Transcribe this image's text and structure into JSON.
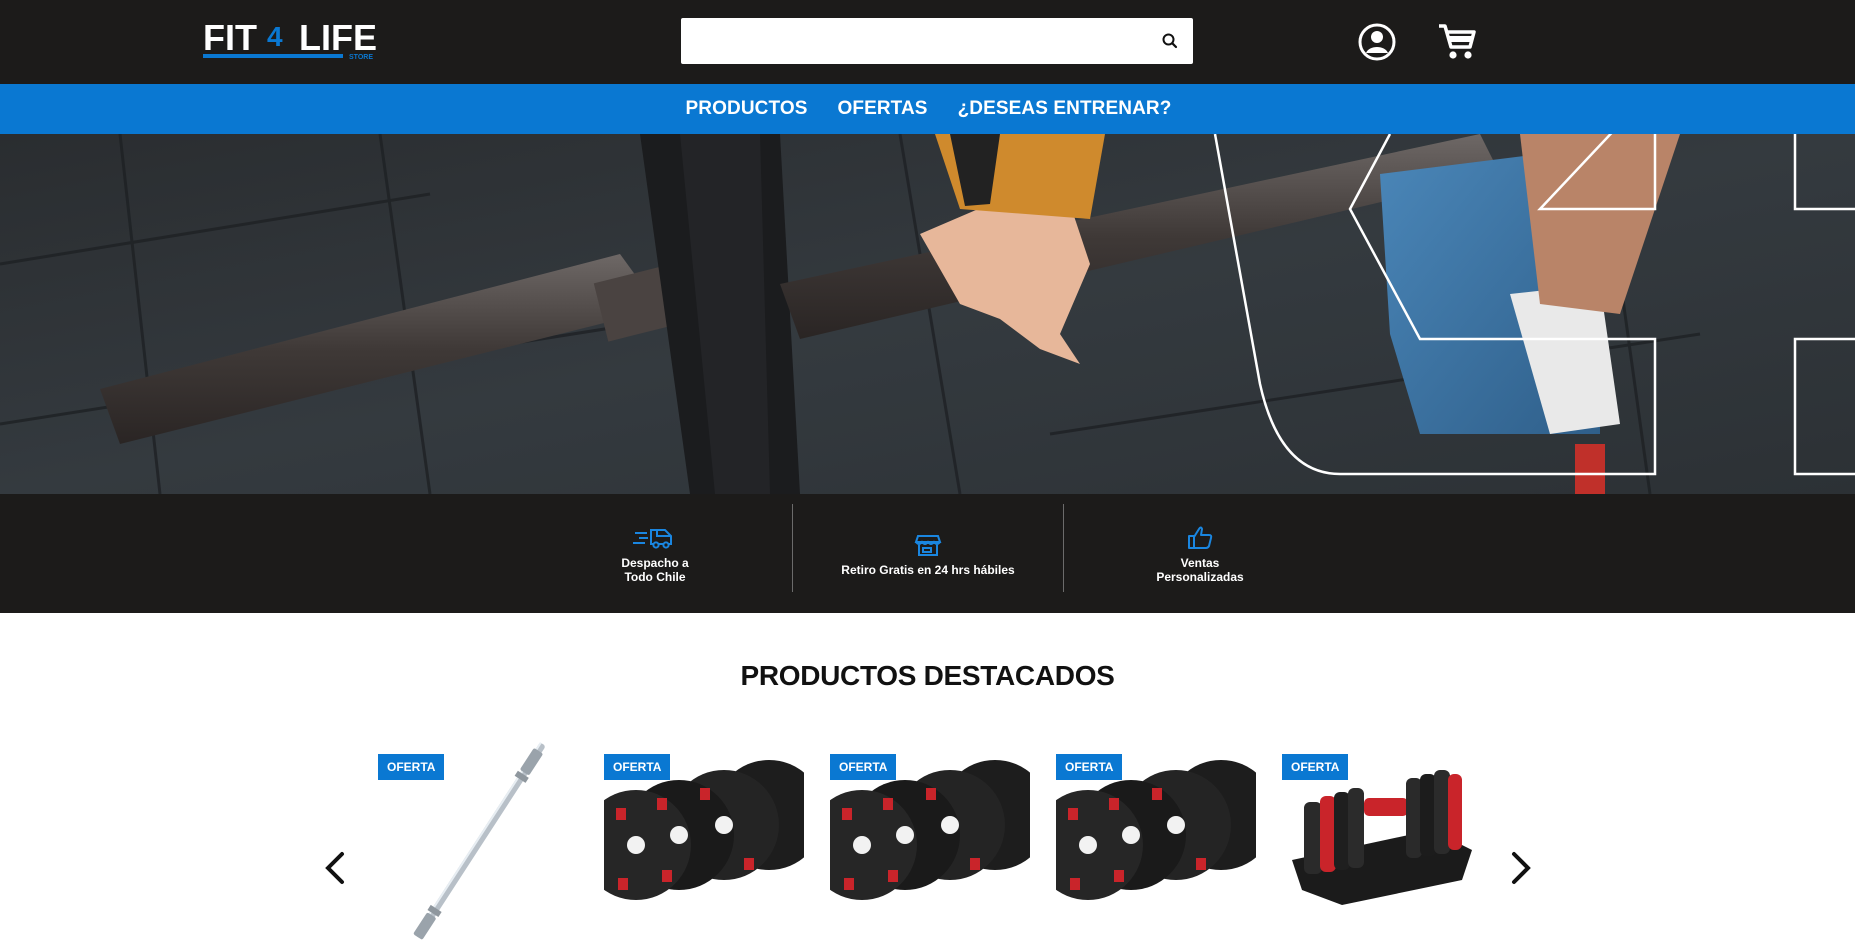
{
  "brand": {
    "name_part1": "FIT",
    "name_number": "4",
    "name_part2": "LIFE",
    "sub": "STORE"
  },
  "search": {
    "placeholder": "",
    "value": ""
  },
  "nav": {
    "items": [
      "PRODUCTOS",
      "OFERTAS",
      "¿DESEAS ENTRENAR?"
    ]
  },
  "features": [
    {
      "line1": "Despacho a",
      "line2": "Todo Chile",
      "icon": "truck-icon"
    },
    {
      "line1": "Retiro Gratis en 24 hrs hábiles",
      "line2": "",
      "icon": "store-icon"
    },
    {
      "line1": "Ventas",
      "line2": "Personalizadas",
      "icon": "thumbs-up-icon"
    }
  ],
  "featured": {
    "title": "PRODUCTOS DESTACADOS",
    "products": [
      {
        "badge": "OFERTA",
        "image": "barbell"
      },
      {
        "badge": "OFERTA",
        "image": "weight-plates"
      },
      {
        "badge": "OFERTA",
        "image": "weight-plates"
      },
      {
        "badge": "OFERTA",
        "image": "weight-plates"
      },
      {
        "badge": "OFERTA",
        "image": "adjustable-dumbbell"
      }
    ]
  },
  "colors": {
    "accent": "#0a78d2",
    "dark": "#1c1b1a"
  }
}
